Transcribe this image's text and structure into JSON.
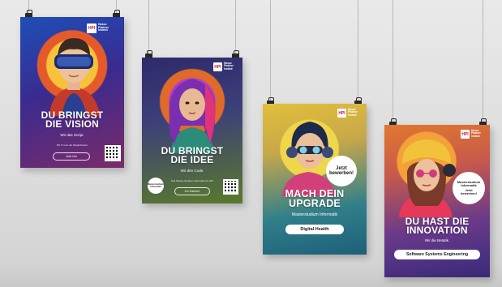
{
  "scene": {
    "background": "#dedede"
  },
  "posters": [
    {
      "id": "vision",
      "logo": {
        "mark": "HPI",
        "lines": [
          "Hasso",
          "Plattner",
          "Institut"
        ]
      },
      "headline": [
        "DU BRINGST",
        "DIE VISION"
      ],
      "subline": "Wir das Script.",
      "caption": "Wir IT-Lust die Möglichkeiten",
      "button": "Jetzt Info",
      "colors": {
        "bg_top": "#1d4fb8",
        "bg_bottom": "#6a2a7a",
        "accent": "#f7b733"
      }
    },
    {
      "id": "idee",
      "logo": {
        "mark": "HPI",
        "lines": [
          "Hasso",
          "Plattner",
          "Institut"
        ]
      },
      "headline": [
        "DU BRINGST",
        "DIE IDEE"
      ],
      "subline": "Wir den Code.",
      "badge": [
        "Masterstudium",
        "Informatik"
      ],
      "caption": "Das Master-Studium Informatik am HPI",
      "button": "Zur Karriere",
      "colors": {
        "bg_top": "#2e2a6b",
        "bg_bottom": "#6e8a2a",
        "accent": "#e84a8a"
      }
    },
    {
      "id": "upgrade",
      "logo": {
        "mark": "HPI",
        "lines": [
          "Hasso",
          "Plattner",
          "Institut"
        ]
      },
      "bubble": [
        "Jetzt",
        "bewerben!"
      ],
      "headline": [
        "MACH DEIN",
        "UPGRADE"
      ],
      "subline": "Masterstudium Informatik",
      "button": "Digital Health",
      "colors": {
        "bg_top": "#e6c23a",
        "bg_bottom": "#1f6f8a",
        "accent": "#d23b8a"
      }
    },
    {
      "id": "innovation",
      "logo": {
        "mark": "HPI",
        "lines": [
          "Hasso",
          "Plattner",
          "Institut"
        ]
      },
      "bubble": [
        "Masterstudium",
        "Informatik",
        "Jetzt",
        "bewerben!"
      ],
      "headline": [
        "DU HAST DIE",
        "INNOVATION"
      ],
      "subline": "Wir die Betatik.",
      "button": "Software Systems Engineering",
      "colors": {
        "bg_top": "#e07a2f",
        "bg_bottom": "#4a2a8a",
        "accent": "#e8385a"
      }
    }
  ]
}
